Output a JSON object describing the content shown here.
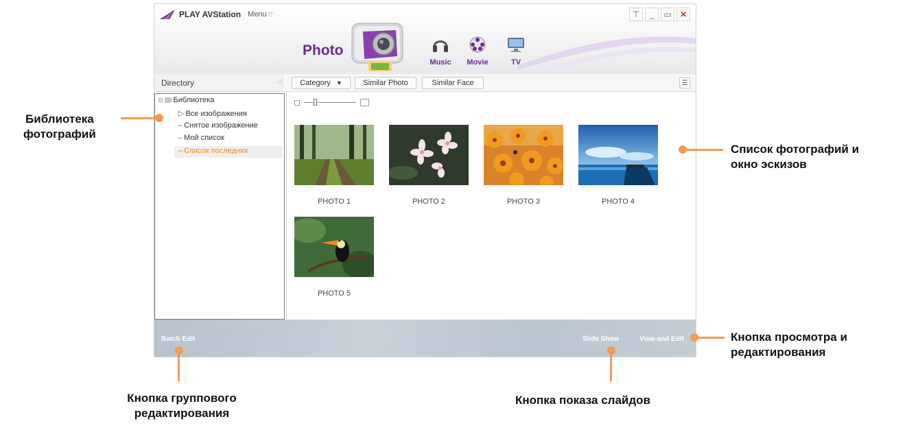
{
  "window": {
    "app_name": "PLAY AVStation",
    "menu_label": "Menu",
    "controls": [
      "⊤",
      "_",
      "▭",
      "✕"
    ]
  },
  "media_tabs": {
    "active": "Photo",
    "items": [
      "Music",
      "Movie",
      "TV"
    ]
  },
  "directory": {
    "header": "Directory",
    "root": "Библиотека",
    "items": [
      "Все изображения",
      "Снятое изображение",
      "Мой список",
      "Список последних"
    ],
    "active_item": "Список последних"
  },
  "toolbar": {
    "category": "Category",
    "similar_photo": "Similar Photo",
    "similar_face": "Similar Face"
  },
  "photos": [
    "PHOTO 1",
    "PHOTO 2",
    "PHOTO 3",
    "PHOTO 4",
    "PHOTO 5"
  ],
  "bottom_bar": {
    "batch_edit": "Batch Edit",
    "slide_show": "Slide Show",
    "view_and_edit": "View and Edit"
  },
  "annotations": {
    "library_line1": "Библиотека",
    "library_line2": "фотографий",
    "list_line1": "Список фотографий и",
    "list_line2": "окно эскизов",
    "view_line1": "Кнопка просмотра и",
    "view_line2": "редактирования",
    "batch_line1": "Кнопка группового",
    "batch_line2": "редактирования",
    "slideshow": "Кнопка показа слайдов"
  },
  "colors": {
    "accent_purple": "#6a2d8f",
    "callout_orange": "#f39a53",
    "active_item_orange": "#ee8a2a"
  }
}
